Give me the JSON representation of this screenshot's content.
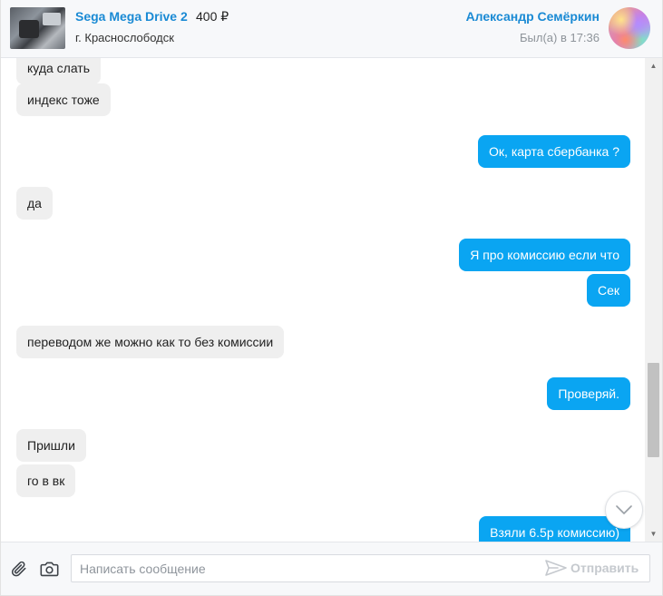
{
  "header": {
    "item_title": "Sega Mega Drive 2",
    "item_price": "400 ₽",
    "item_city": "г. Краснослободск",
    "user_name": "Александр Семёркин",
    "user_status": "Был(а) в 17:36"
  },
  "messages": [
    {
      "direction": "in",
      "text": "куда слать"
    },
    {
      "direction": "in",
      "text": "индекс тоже"
    },
    {
      "direction": "out",
      "text": "Ок, карта сбербанка ?"
    },
    {
      "direction": "in",
      "text": "да"
    },
    {
      "direction": "out",
      "text": "Я про комиссию если что"
    },
    {
      "direction": "out",
      "text": "Сек"
    },
    {
      "direction": "in",
      "text": "переводом же можно как то без комиссии"
    },
    {
      "direction": "out",
      "text": "Проверяй."
    },
    {
      "direction": "in",
      "text": "Пришли"
    },
    {
      "direction": "in",
      "text": "го в вк"
    },
    {
      "direction": "out",
      "text": "Взяли 6.5р комиссию)"
    }
  ],
  "composer": {
    "placeholder": "Написать сообщение",
    "send_label": "Отправить"
  },
  "icons": {
    "attach": "paperclip-icon",
    "camera": "camera-icon",
    "send": "paper-plane-icon",
    "scroll_down": "chevron-down-icon"
  },
  "colors": {
    "accent": "#1a8ad4",
    "outgoing_bubble": "#0aa5f2",
    "incoming_bubble": "#efefef",
    "send_disabled": "#c5c9ce"
  }
}
